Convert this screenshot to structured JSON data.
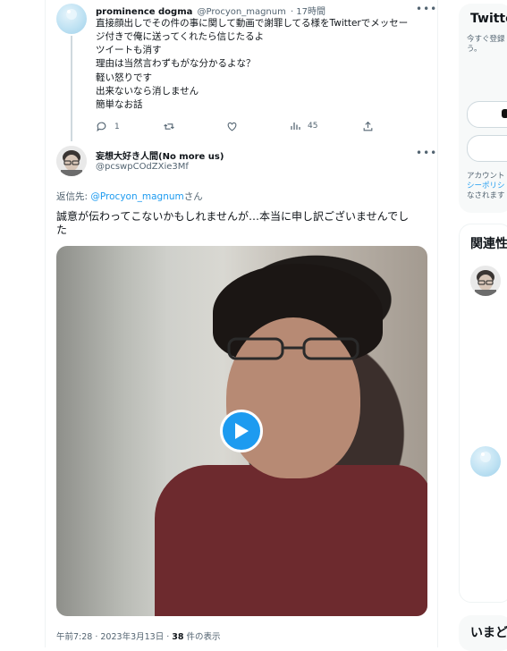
{
  "tweet1": {
    "name": "prominence dogma",
    "handle": "@Procyon_magnum",
    "time": "· 17時間",
    "lines": [
      "直接顔出しでその件の事に関して動画で謝罪してる様をTwitterでメッセー",
      "ジ付きで俺に送ってくれたら信じたるよ",
      "ツイートも消す",
      "理由は当然言わずもがな分かるよな？",
      "軽い怒りです",
      "出来ないなら消しません",
      "簡単なお話"
    ],
    "replies": "1",
    "views": "45"
  },
  "tweet2": {
    "name": "妄想大好き人間(No more us)",
    "handle": "@pcswpCOdZXie3Mf",
    "reply_prefix": "返信先: ",
    "reply_to": "@Procyon_magnum",
    "reply_suffix": "さん",
    "text_line1": "誠意が伝わってこないかもしれませんが…本当に申し訳ございませんでし",
    "text_line2": "た",
    "meta_time": "午前7:28 · 2023年3月13日 · ",
    "meta_views_num": "38",
    "meta_views_label": " 件の表示"
  },
  "sidebar": {
    "twitter_title": "Twitte",
    "signup_line1": "今すぐ登録",
    "signup_line2": "う。",
    "account_line": "アカウント",
    "policy_line": "シーポリシ",
    "consent_line": "なされます",
    "related_title": "関連性",
    "now_title": "いまど"
  },
  "colors": {
    "accent": "#1d9bf0",
    "muted": "#536471",
    "border": "#eff3f4"
  },
  "icons": [
    "reply-icon",
    "retweet-icon",
    "like-icon",
    "views-icon",
    "share-icon",
    "play-icon",
    "more-icon"
  ]
}
